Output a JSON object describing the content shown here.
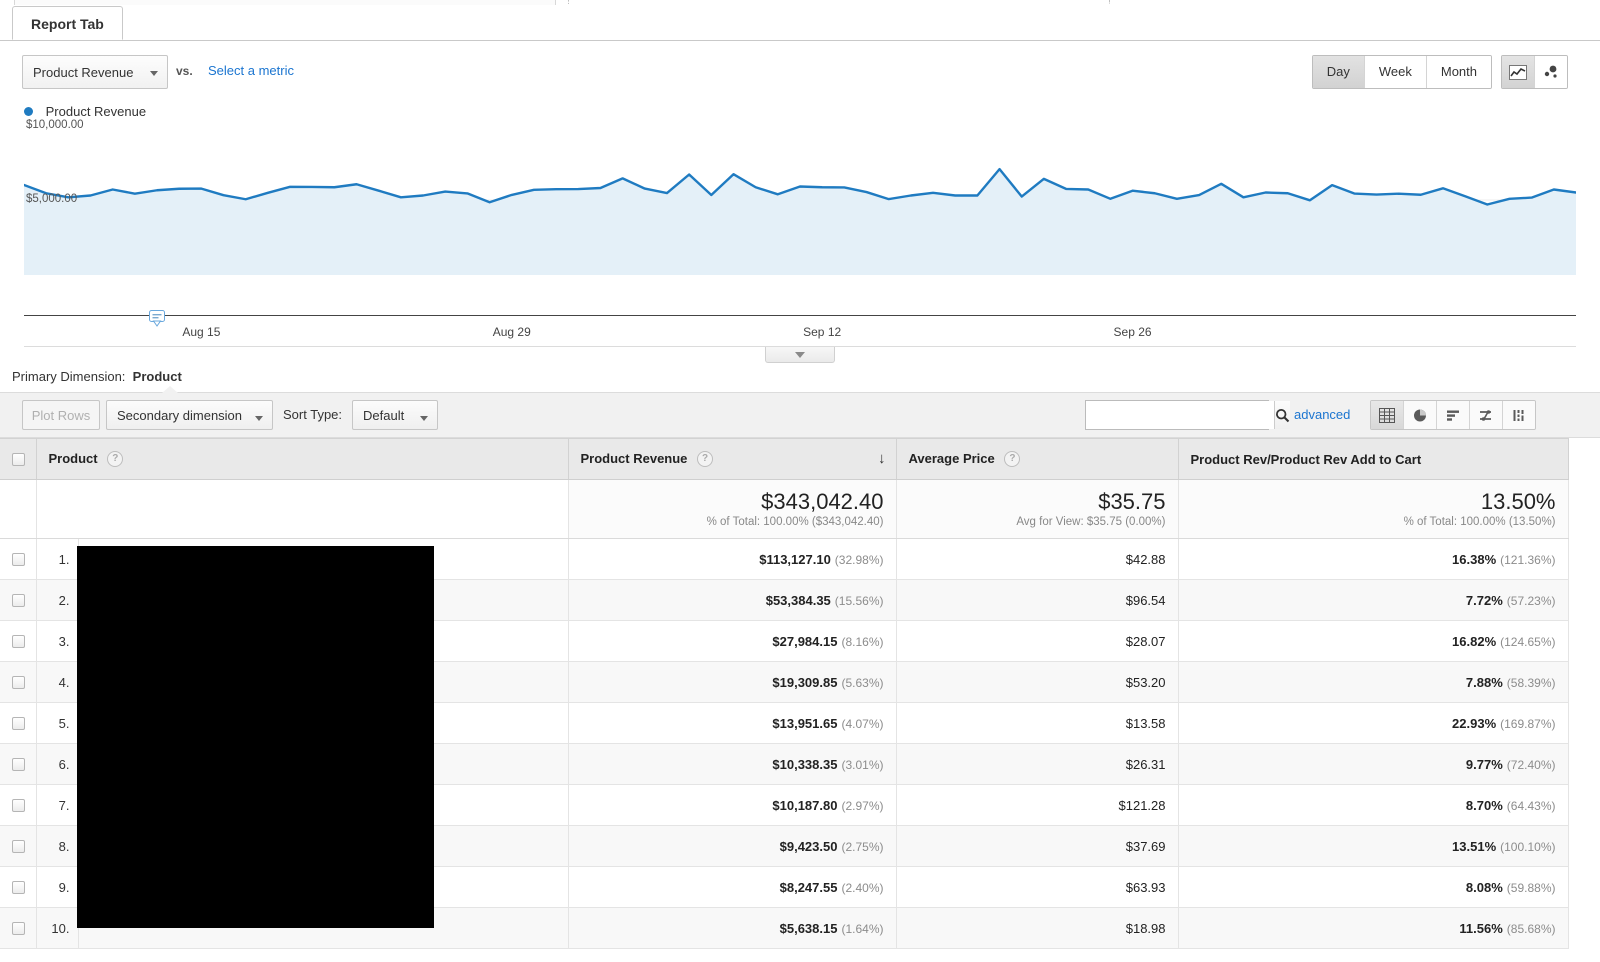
{
  "tab": {
    "label": "Report Tab"
  },
  "metric_bar": {
    "primary_metric": "Product Revenue",
    "vs_label": "vs.",
    "select_metric_link": "Select a metric",
    "granularity": [
      "Day",
      "Week",
      "Month"
    ],
    "granularity_selected": "Day",
    "chart_type_icons": [
      "line-chart-icon",
      "motion-chart-icon"
    ],
    "chart_type_selected": "line-chart-icon"
  },
  "chart": {
    "legend_label": "Product Revenue",
    "series_color": "#1f7bc1",
    "fill_color": "#e4f0f8"
  },
  "chart_data": {
    "type": "line",
    "title": "Product Revenue",
    "xlabel": "",
    "ylabel": "",
    "ylim": [
      0,
      10000
    ],
    "ytick_labels": [
      "$10,000.00",
      "$5,000.00"
    ],
    "ytick_values": [
      10000,
      5000
    ],
    "xtick_labels": [
      "Aug 15",
      "Aug 29",
      "Sep 12",
      "Sep 26"
    ],
    "xtick_indices": [
      8,
      22,
      36,
      50
    ],
    "grid": false,
    "legend_position": "top-left",
    "annotation_marker_index": 6,
    "series": [
      {
        "name": "Product Revenue",
        "values": [
          6000,
          5450,
          5180,
          5300,
          5700,
          5420,
          5650,
          5750,
          5760,
          5320,
          5050,
          5480,
          5880,
          5870,
          5850,
          6050,
          5620,
          5180,
          5300,
          5560,
          5440,
          4850,
          5340,
          5680,
          5720,
          5730,
          5800,
          6440,
          5760,
          5460,
          6700,
          5330,
          6720,
          5850,
          5380,
          5900,
          5850,
          5840,
          5530,
          5060,
          5300,
          5480,
          5300,
          5300,
          7060,
          5230,
          6410,
          5740,
          5700,
          5080,
          5620,
          5450,
          5080,
          5330,
          6080,
          5180,
          5500,
          5450,
          4980,
          5990,
          5430,
          5360,
          5420,
          5350,
          5780,
          5250,
          4700,
          5080,
          5160,
          5700,
          5500
        ]
      }
    ]
  },
  "primary_dimension": {
    "label": "Primary Dimension:",
    "value": "Product"
  },
  "toolbar": {
    "plot_rows_label": "Plot Rows",
    "secondary_dimension_label": "Secondary dimension",
    "sort_type_label": "Sort Type:",
    "sort_type_value": "Default",
    "search_value": "",
    "search_placeholder": "",
    "advanced_label": "advanced",
    "view_icons": [
      "table-view-icon",
      "pie-chart-view-icon",
      "performance-view-icon",
      "comparison-view-icon",
      "pivot-view-icon"
    ],
    "view_selected": "table-view-icon"
  },
  "table": {
    "headers": [
      {
        "label": "Product",
        "help": true,
        "sorted": false
      },
      {
        "label": "Product Revenue",
        "help": true,
        "sorted": true,
        "sort_direction": "desc"
      },
      {
        "label": "Average Price",
        "help": true,
        "sorted": false
      },
      {
        "label": "Product Rev/Product Rev Add to Cart",
        "help": false,
        "sorted": false
      }
    ],
    "summary": {
      "revenue_value": "$343,042.40",
      "revenue_sub": "% of Total: 100.00% ($343,042.40)",
      "price_value": "$35.75",
      "price_sub": "Avg for View: $35.75 (0.00%)",
      "ratio_value": "13.50%",
      "ratio_sub": "% of Total: 100.00% (13.50%)"
    },
    "rows": [
      {
        "index": "1.",
        "product": "",
        "revenue": "$113,127.10",
        "revenue_pct": "(32.98%)",
        "price": "$42.88",
        "ratio": "16.38%",
        "ratio_pct": "(121.36%)"
      },
      {
        "index": "2.",
        "product": "",
        "revenue": "$53,384.35",
        "revenue_pct": "(15.56%)",
        "price": "$96.54",
        "ratio": "7.72%",
        "ratio_pct": "(57.23%)"
      },
      {
        "index": "3.",
        "product": "",
        "revenue": "$27,984.15",
        "revenue_pct": "(8.16%)",
        "price": "$28.07",
        "ratio": "16.82%",
        "ratio_pct": "(124.65%)"
      },
      {
        "index": "4.",
        "product": "",
        "revenue": "$19,309.85",
        "revenue_pct": "(5.63%)",
        "price": "$53.20",
        "ratio": "7.88%",
        "ratio_pct": "(58.39%)"
      },
      {
        "index": "5.",
        "product": "",
        "revenue": "$13,951.65",
        "revenue_pct": "(4.07%)",
        "price": "$13.58",
        "ratio": "22.93%",
        "ratio_pct": "(169.87%)"
      },
      {
        "index": "6.",
        "product": "",
        "revenue": "$10,338.35",
        "revenue_pct": "(3.01%)",
        "price": "$26.31",
        "ratio": "9.77%",
        "ratio_pct": "(72.40%)"
      },
      {
        "index": "7.",
        "product": "",
        "revenue": "$10,187.80",
        "revenue_pct": "(2.97%)",
        "price": "$121.28",
        "ratio": "8.70%",
        "ratio_pct": "(64.43%)"
      },
      {
        "index": "8.",
        "product": "",
        "revenue": "$9,423.50",
        "revenue_pct": "(2.75%)",
        "price": "$37.69",
        "ratio": "13.51%",
        "ratio_pct": "(100.10%)"
      },
      {
        "index": "9.",
        "product": "",
        "revenue": "$8,247.55",
        "revenue_pct": "(2.40%)",
        "price": "$63.93",
        "ratio": "8.08%",
        "ratio_pct": "(59.88%)"
      },
      {
        "index": "10.",
        "product": "",
        "revenue": "$5,638.15",
        "revenue_pct": "(1.64%)",
        "price": "$18.98",
        "ratio": "11.56%",
        "ratio_pct": "(85.68%)"
      }
    ]
  }
}
